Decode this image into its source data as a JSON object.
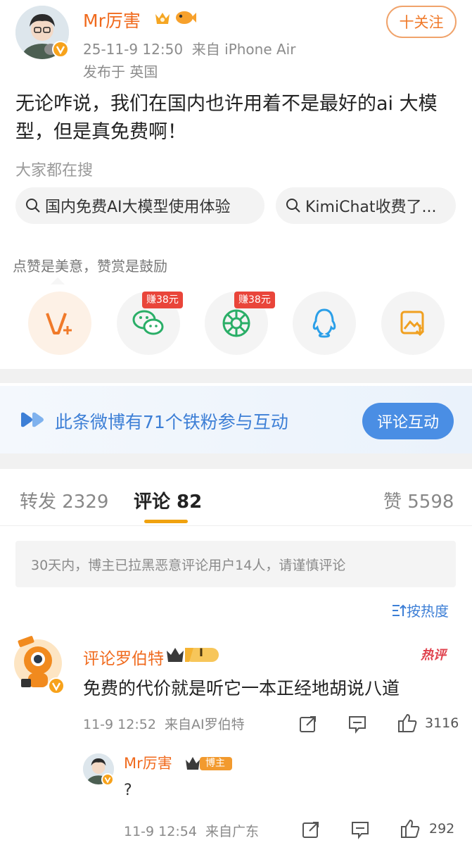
{
  "post": {
    "author": "Mr厉害",
    "follow_label": "十关注",
    "time": "25-11-9 12:50",
    "source": "来自 iPhone Air",
    "location": "发布于 英国",
    "content": "无论咋说，我们在国内也许用着不是最好的ai 大模型，但是真免费啊！"
  },
  "search": {
    "title": "大家都在搜",
    "chips": [
      "国内免费AI大模型使用体验",
      "KimiChat收费了..."
    ]
  },
  "share": {
    "tip": "点赞是美意，赞赏是鼓励",
    "earn_wechat": "赚38元",
    "earn_moments": "赚38元",
    "icons": [
      "v-plus-icon",
      "wechat-icon",
      "moments-icon",
      "qq-icon",
      "save-image-icon"
    ]
  },
  "fans": {
    "text": "此条微博有71个铁粉参与互动",
    "button": "评论互动"
  },
  "tabs": {
    "repost": "转发 2329",
    "comments": "评论 82",
    "likes": "赞 5598"
  },
  "notice": "30天内，博主已拉黑恶意评论用户14人，请谨慎评论",
  "sort_label": "按热度",
  "comment": {
    "name": "评论罗伯特",
    "level": "I",
    "hot_label": "热评",
    "text": "免费的代价就是听它一本正经地胡说八道",
    "time": "11-9 12:52",
    "source": "来自AI罗伯特",
    "like_count": "3116"
  },
  "reply": {
    "name": "Mr厉害",
    "badge": "博主",
    "text": "?",
    "time": "11-9 12:54",
    "source": "来自广东",
    "like_count": "292"
  },
  "colors": {
    "accent_orange": "#f06a1d",
    "link_blue": "#3d7fd6",
    "tab_underline": "#f0a20f",
    "earn_red": "#e9453a"
  }
}
